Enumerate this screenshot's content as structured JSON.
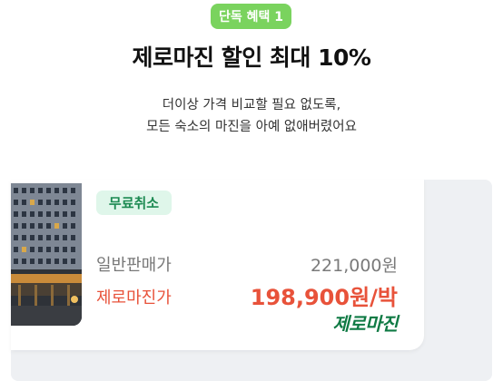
{
  "promo": {
    "badge": "단독 혜택 1",
    "headline": "제로마진 할인 최대 10%",
    "description_line1": "더이상 가격 비교할 필요 없도록,",
    "description_line2": "모든 숙소의 마진을 아예 없애버렸어요"
  },
  "card": {
    "tag": "무료취소",
    "regular_label": "일반판매가",
    "regular_price": "221,000원",
    "zero_label": "제로마진가",
    "zero_price": "198,900원/박",
    "brand_logo": "제로마진"
  },
  "colors": {
    "badge_bg": "#7ad35e",
    "accent_red": "#e8523a",
    "brand_green": "#0f7a44",
    "tag_bg": "#dff6ea"
  }
}
